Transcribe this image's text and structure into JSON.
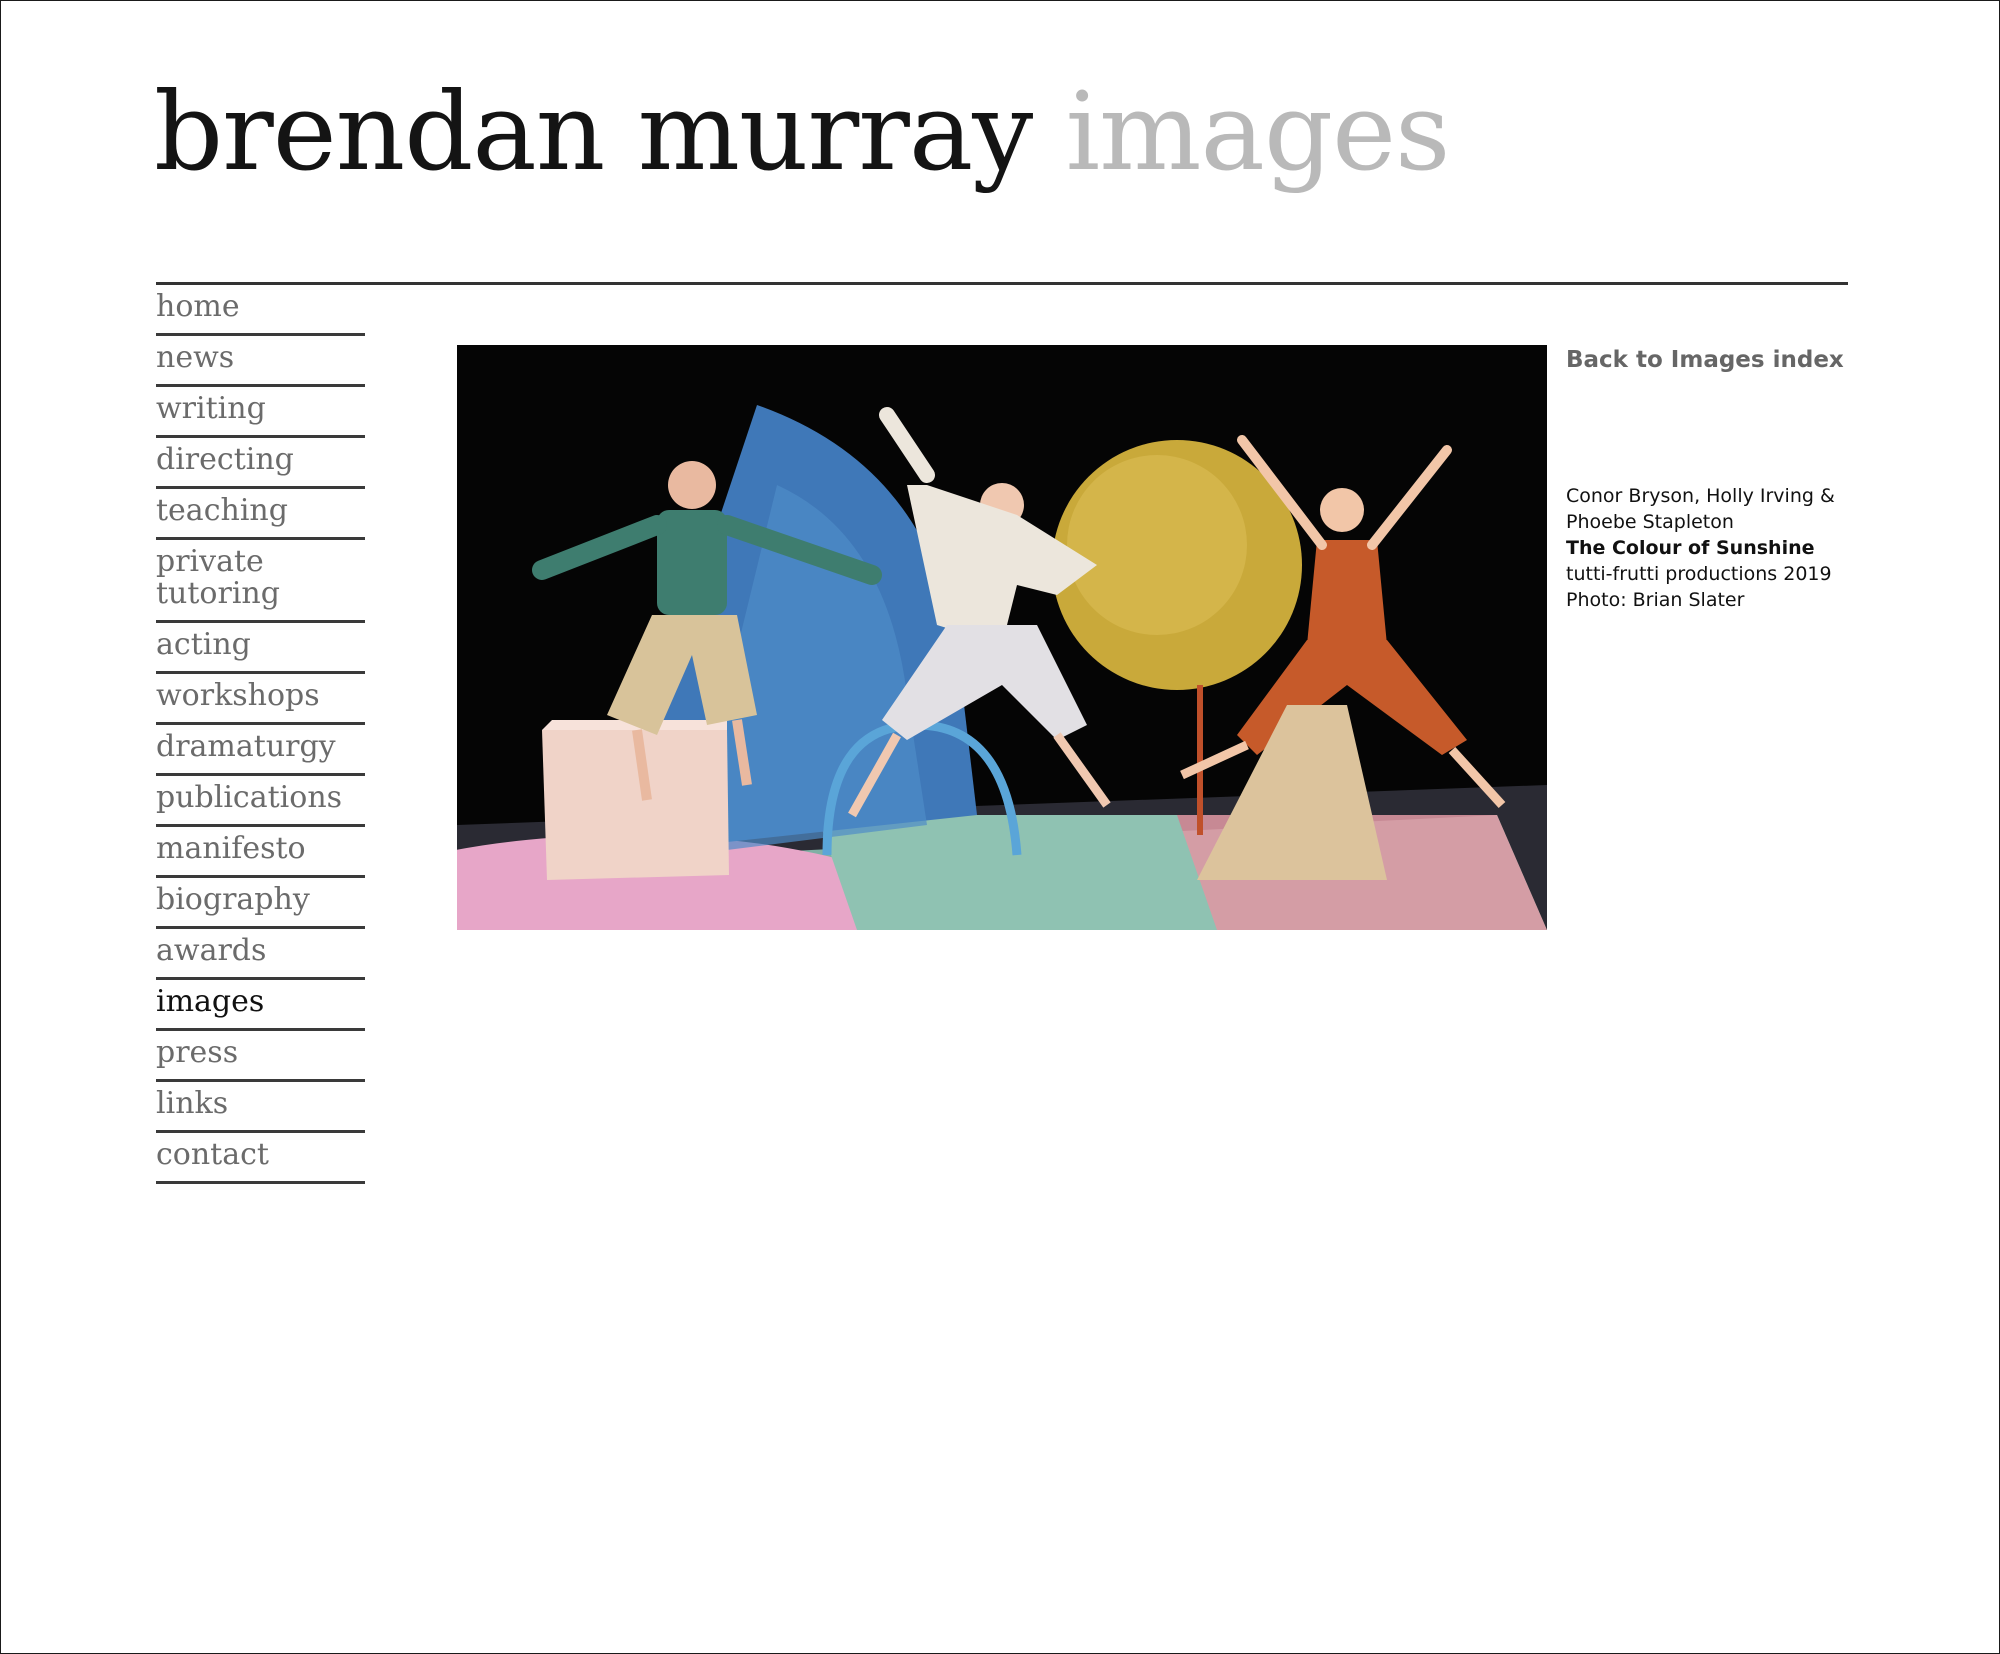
{
  "header": {
    "name": "brendan murray",
    "section": "images"
  },
  "nav": {
    "items": [
      {
        "label": "home"
      },
      {
        "label": "news"
      },
      {
        "label": "writing"
      },
      {
        "label": "directing"
      },
      {
        "label": "teaching"
      },
      {
        "label": "private tutoring"
      },
      {
        "label": "acting"
      },
      {
        "label": "workshops"
      },
      {
        "label": "dramaturgy"
      },
      {
        "label": "publications"
      },
      {
        "label": "manifesto"
      },
      {
        "label": "biography"
      },
      {
        "label": "awards"
      },
      {
        "label": "images"
      },
      {
        "label": "press"
      },
      {
        "label": "links"
      },
      {
        "label": "contact"
      }
    ],
    "active": "images"
  },
  "main": {
    "back_link": "Back to Images index",
    "caption": {
      "performers_line1": "Conor Bryson, Holly Irving &",
      "performers_line2": "Phoebe Stapleton",
      "production_title": "The Colour of Sunshine",
      "company": "tutti-frutti productions 2019",
      "credit": "Photo: Brian Slater"
    }
  },
  "colors": {
    "text_dark": "#141414",
    "title_light": "#b9b9b9",
    "nav_text": "#6b6b6b",
    "rule": "#333333"
  }
}
